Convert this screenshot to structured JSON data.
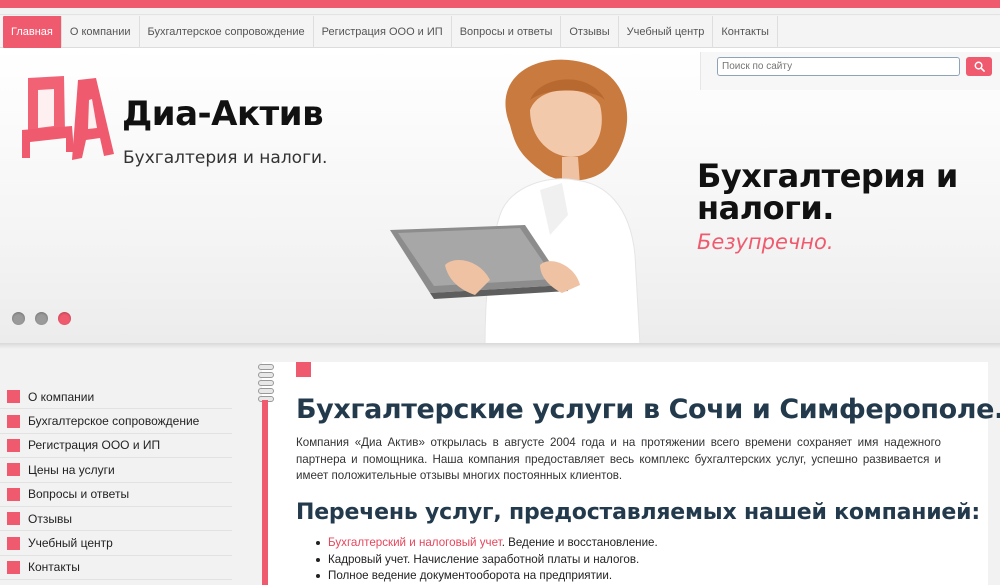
{
  "nav": {
    "items": [
      {
        "label": "Главная",
        "active": true
      },
      {
        "label": "О компании"
      },
      {
        "label": "Бухгалтерское сопровождение"
      },
      {
        "label": "Регистрация ООО и ИП"
      },
      {
        "label": "Вопросы и ответы"
      },
      {
        "label": "Отзывы"
      },
      {
        "label": "Учебный центр"
      },
      {
        "label": "Контакты"
      }
    ]
  },
  "search": {
    "placeholder": "Поиск по сайту",
    "icon": "search-icon"
  },
  "logo": {
    "mark": "ДА",
    "name": "Диа-Актив",
    "tagline": "Бухгалтерия и налоги."
  },
  "hero": {
    "headline_line1": "Бухгалтерия и",
    "headline_line2": "налоги.",
    "subline": "Безупречно.",
    "slides_total": 3,
    "active_slide": 3
  },
  "sidebar": {
    "items": [
      {
        "label": "О компании"
      },
      {
        "label": "Бухгалтерское сопровождение"
      },
      {
        "label": "Регистрация ООО и ИП"
      },
      {
        "label": "Цены на услуги"
      },
      {
        "label": "Вопросы и ответы"
      },
      {
        "label": "Отзывы"
      },
      {
        "label": "Учебный центр"
      },
      {
        "label": "Контакты"
      }
    ]
  },
  "main": {
    "title": "Бухгалтерские услуги в Сочи и Симферополе.",
    "intro": "Компания «Диа Актив» открылась в августе 2004 года и на протяжении всего времени сохраняет имя надежного партнера и помощника. Наша компания предоставляет весь комплекс бухгалтерских услуг, успешно развивается и имеет положительные отзывы многих постоянных клиентов.",
    "services_title": "Перечень услуг, предоставляемых нашей компанией:",
    "services": [
      {
        "link": "Бухгалтерский и налоговый учет",
        "rest": ". Ведение и восстановление."
      },
      {
        "link": "",
        "rest": "Кадровый учет. Начисление заработной платы и налогов."
      },
      {
        "link": "",
        "rest": "Полное ведение документооборота на предприятии."
      }
    ]
  },
  "colors": {
    "accent": "#f05a6e",
    "heading": "#233a4d"
  }
}
